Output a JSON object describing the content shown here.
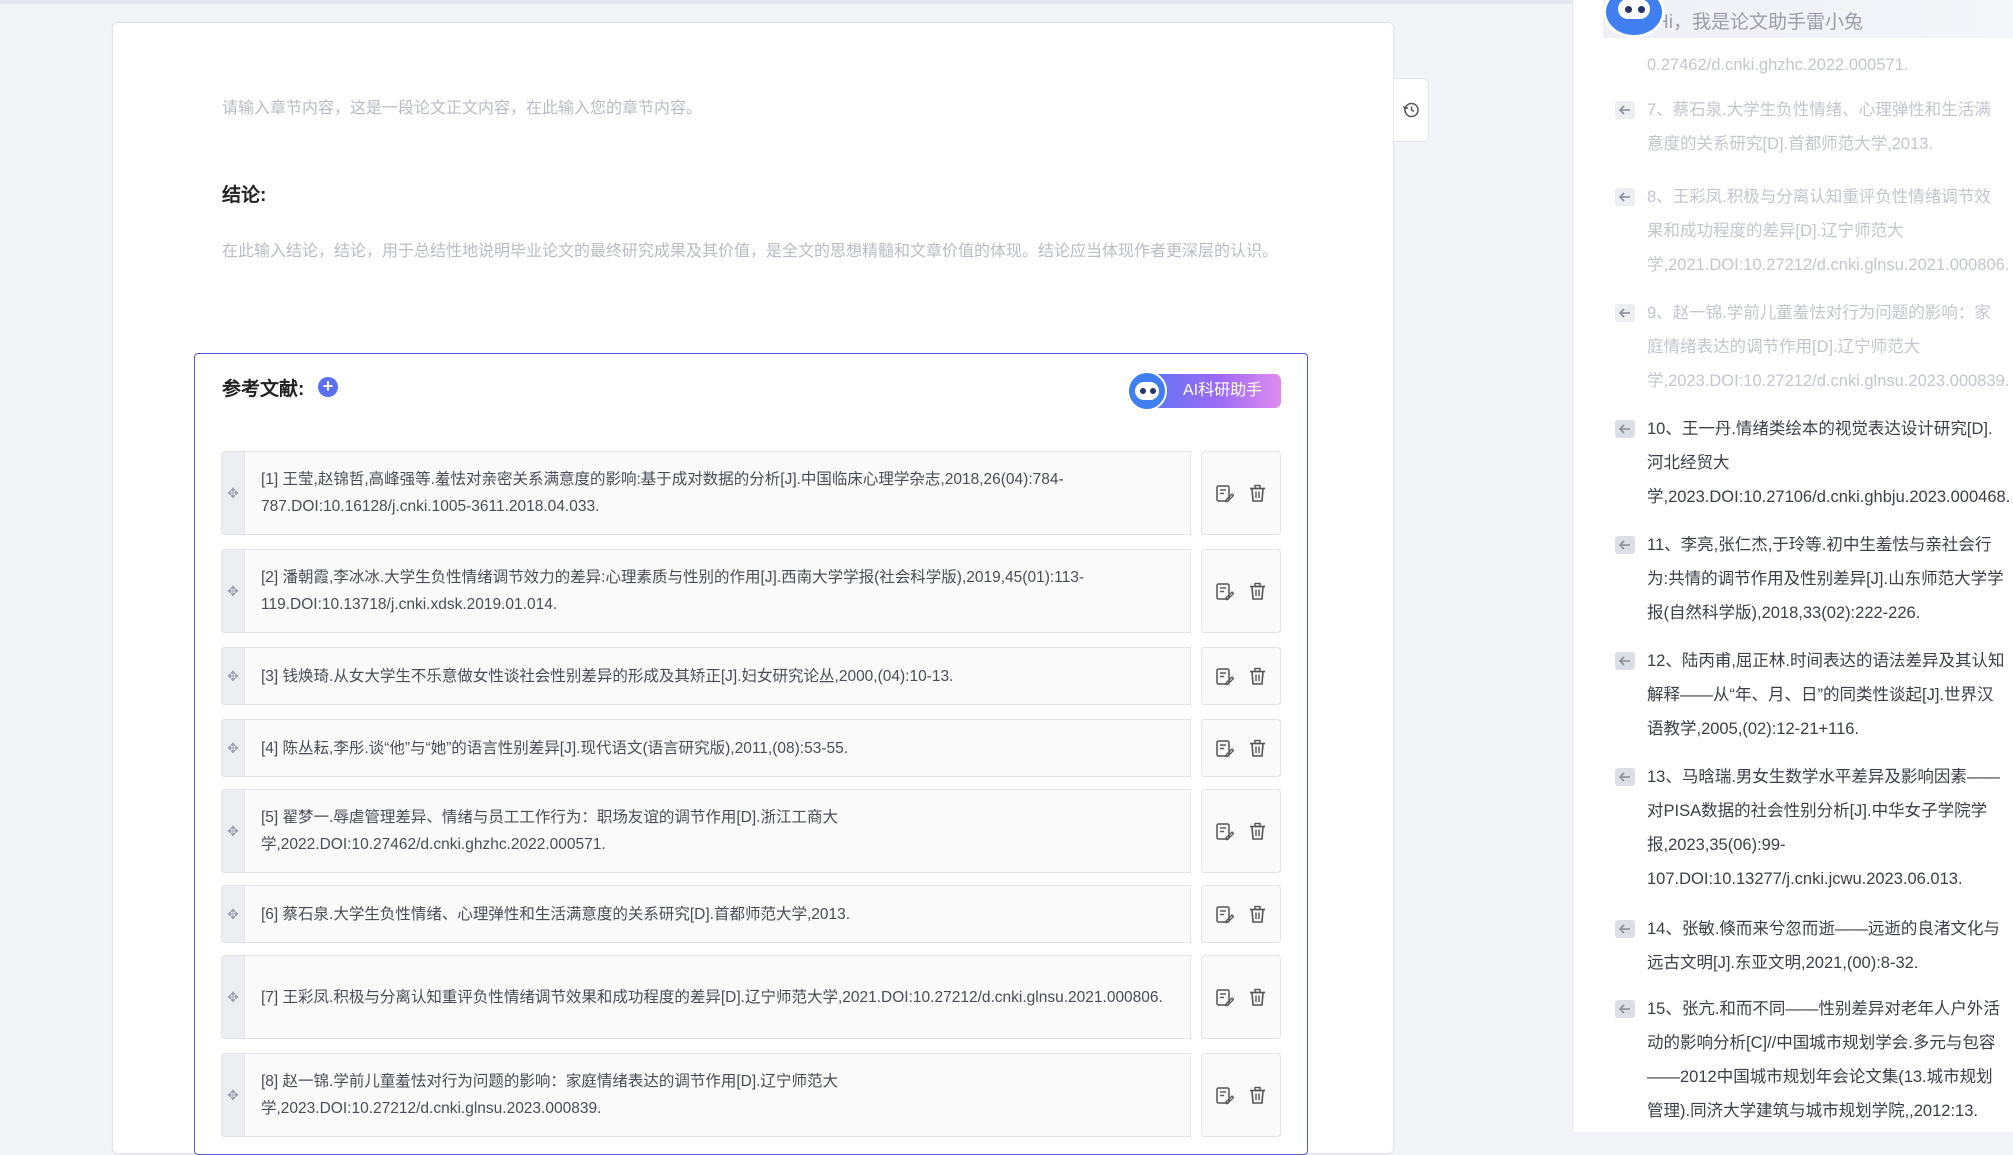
{
  "editor": {
    "placeholder_section": "请输入章节内容，这是一段论文正文内容，在此输入您的章节内容。",
    "conclusion_title": "结论:",
    "conclusion_placeholder": "在此输入结论，结论，用于总结性地说明毕业论文的最终研究成果及其价值，是全文的思想精髓和文章价值的体现。结论应当体现作者更深层的认识。"
  },
  "references": {
    "title": "参考文献:",
    "add_label": "+",
    "ai_button_label": "AI科研助手",
    "items": [
      {
        "text": "[1] 王莹,赵锦哲,高峰强等.羞怯对亲密关系满意度的影响:基于成对数据的分析[J].中国临床心理学杂志,2018,26(04):784-787.DOI:10.16128/j.cnki.1005-3611.2018.04.033."
      },
      {
        "text": "[2] 潘朝霞,李冰冰.大学生负性情绪调节效力的差异:心理素质与性别的作用[J].西南大学学报(社会科学版),2019,45(01):113-119.DOI:10.13718/j.cnki.xdsk.2019.01.014."
      },
      {
        "text": "[3] 钱焕琦.从女大学生不乐意做女性谈社会性别差异的形成及其矫正[J].妇女研究论丛,2000,(04):10-13."
      },
      {
        "text": "[4] 陈丛耘,李彤.谈“他”与“她”的语言性别差异[J].现代语文(语言研究版),2011,(08):53-55."
      },
      {
        "text": "[5] 翟梦一.辱虐管理差异、情绪与员工工作行为：职场友谊的调节作用[D].浙江工商大学,2022.DOI:10.27462/d.cnki.ghzhc.2022.000571."
      },
      {
        "text": "[6] 蔡石泉.大学生负性情绪、心理弹性和生活满意度的关系研究[D].首都师范大学,2013."
      },
      {
        "text": "[7] 王彩凤.积极与分离认知重评负性情绪调节效果和成功程度的差异[D].辽宁师范大学,2021.DOI:10.27212/d.cnki.glnsu.2021.000806."
      },
      {
        "text": "[8] 赵一锦.学前儿童羞怯对行为问题的影响：家庭情绪表达的调节作用[D].辽宁师范大学,2023.DOI:10.27212/d.cnki.glnsu.2023.000839."
      }
    ]
  },
  "assistant": {
    "greeting": "Hi，我是论文助手雷小兔",
    "items": [
      {
        "text": "0.27462/d.cnki.ghzhc.2022.000571.",
        "faded": true,
        "icon": false
      },
      {
        "text": "7、蔡石泉.大学生负性情绪、心理弹性和生活满意度的关系研究[D].首都师范大学,2013.",
        "faded": true,
        "icon": true
      },
      {
        "text": "8、王彩凤.积极与分离认知重评负性情绪调节效果和成功程度的差异[D].辽宁师范大学,2021.DOI:10.27212/d.cnki.glnsu.2021.000806.",
        "faded": true,
        "icon": true
      },
      {
        "text": "9、赵一锦.学前儿童羞怯对行为问题的影响：家庭情绪表达的调节作用[D].辽宁师范大学,2023.DOI:10.27212/d.cnki.glnsu.2023.000839.",
        "faded": true,
        "icon": true
      },
      {
        "text": "10、王一丹.情绪类绘本的视觉表达设计研究[D].河北经贸大学,2023.DOI:10.27106/d.cnki.ghbju.2023.000468.",
        "faded": false,
        "icon": true
      },
      {
        "text": "11、李亮,张仁杰,于玲等.初中生羞怯与亲社会行为:共情的调节作用及性别差异[J].山东师范大学学报(自然科学版),2018,33(02):222-226.",
        "faded": false,
        "icon": true
      },
      {
        "text": "12、陆丙甫,屈正林.时间表达的语法差异及其认知解释——从“年、月、日”的同类性谈起[J].世界汉语教学,2005,(02):12-21+116.",
        "faded": false,
        "icon": true
      },
      {
        "text": "13、马晗瑞.男女生数学水平差异及影响因素——对PISA数据的社会性别分析[J].中华女子学院学报,2023,35(06):99-107.DOI:10.13277/j.cnki.jcwu.2023.06.013.",
        "faded": false,
        "icon": true
      },
      {
        "text": "14、张敏.倏而来兮忽而逝——远逝的良渚文化与远古文明[J].东亚文明,2021,(00):8-32.",
        "faded": false,
        "icon": true
      },
      {
        "text": "15、张亢.和而不同——性别差异对老年人户外活动的影响分析[C]//中国城市规划学会.多元与包容——2012中国城市规划年会论文集(13.城市规划管理).同济大学建筑与城市规划学院,,2012:13.",
        "faded": false,
        "icon": true
      }
    ]
  }
}
